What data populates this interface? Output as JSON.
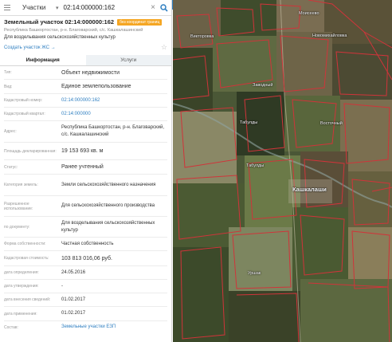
{
  "search": {
    "category": "Участки",
    "query": "02:14:000000:162"
  },
  "object": {
    "title": "Земельный участок 02:14:000000:162",
    "badge": "без координат границ",
    "address": "Республика Башкортостан, р-н. Благоварский, с/с. Кашкалашинский",
    "purpose": "Для возделывания сельскохозяйственных культур",
    "create_link": "Создать участок ЖС →"
  },
  "tabs": [
    {
      "label": "Информация",
      "active": true
    },
    {
      "label": "Услуги",
      "active": false
    }
  ],
  "fields": [
    {
      "label": "Тип:",
      "value": "Объект недвижимости",
      "link": false
    },
    {
      "label": "Вид:",
      "value": "Единое землепользование",
      "link": false
    },
    {
      "label": "Кадастровый номер:",
      "value": "02:14:000000:162",
      "link": true
    },
    {
      "label": "Кадастровый квартал:",
      "value": "02:14:000000",
      "link": true
    },
    {
      "label": "Адрес:",
      "value": "Республика Башкортостан, р-н. Благоварский, с/с. Кашкалашинский",
      "link": false
    },
    {
      "label": "Площадь декларированная:",
      "value": "19 153 693 кв. м",
      "link": false
    },
    {
      "label": "Статус:",
      "value": "Ранее учтенный",
      "link": false
    },
    {
      "label": "Категория земель:",
      "value": "Земли сельскохозяйственного назначения",
      "link": false
    },
    {
      "label": "Разрешенное использование:",
      "value": "Для сельскохозяйственного производства",
      "link": false
    },
    {
      "label": "по документу:",
      "value": "Для возделывания сельскохозяйственных культур",
      "link": false
    },
    {
      "label": "Форма собственности:",
      "value": "Частная собственность",
      "link": false
    },
    {
      "label": "Кадастровая стоимость:",
      "value": "103 813 016,06 руб.",
      "link": false
    },
    {
      "label": "дата определения:",
      "value": "24.05.2016",
      "link": false
    },
    {
      "label": "дата утверждения:",
      "value": "-",
      "link": false
    },
    {
      "label": "дата внесения сведений:",
      "value": "01.02.2017",
      "link": false
    },
    {
      "label": "дата применения:",
      "value": "01.02.2017",
      "link": false
    },
    {
      "label": "Состав:",
      "value": "Земельные участки ЕЗП",
      "link": true
    }
  ],
  "map_labels": [
    {
      "text": "Моисеево",
      "cls": ""
    },
    {
      "text": "Викторовка",
      "cls": ""
    },
    {
      "text": "Новомихайловка",
      "cls": ""
    },
    {
      "text": "Заводный",
      "cls": ""
    },
    {
      "text": "Восточный",
      "cls": ""
    },
    {
      "text": "Табулды",
      "cls": ""
    },
    {
      "text": "Табулды",
      "cls": ""
    },
    {
      "text": "Кашкалаши",
      "cls": "big"
    },
    {
      "text": "Уршак",
      "cls": ""
    }
  ],
  "colors": {
    "accent": "#2f7fc1",
    "badge": "#f5a623",
    "parcel_border": "#d0343a"
  }
}
